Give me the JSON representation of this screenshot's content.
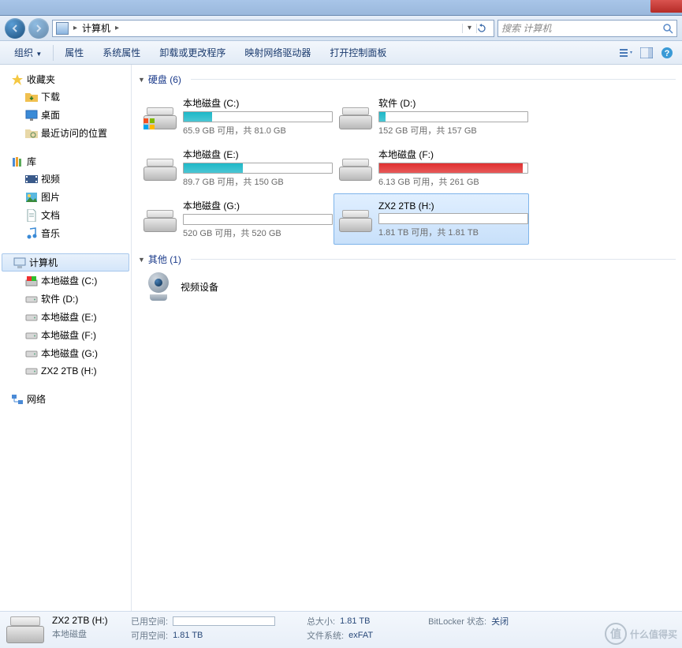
{
  "title_bar": {
    "location": "计算机"
  },
  "search": {
    "placeholder": "搜索 计算机"
  },
  "toolbar": {
    "organize": "组织",
    "dd": "▼",
    "properties": "属性",
    "sysprops": "系统属性",
    "uninstall": "卸载或更改程序",
    "mapnet": "映射网络驱动器",
    "controlpanel": "打开控制面板"
  },
  "sidebar": {
    "favorites": "收藏夹",
    "fav_items": [
      {
        "label": "下载"
      },
      {
        "label": "桌面"
      },
      {
        "label": "最近访问的位置"
      }
    ],
    "libraries": "库",
    "lib_items": [
      {
        "label": "视频"
      },
      {
        "label": "图片"
      },
      {
        "label": "文档"
      },
      {
        "label": "音乐"
      }
    ],
    "computer": "计算机",
    "comp_items": [
      {
        "label": "本地磁盘 (C:)"
      },
      {
        "label": "软件 (D:)"
      },
      {
        "label": "本地磁盘 (E:)"
      },
      {
        "label": "本地磁盘 (F:)"
      },
      {
        "label": "本地磁盘 (G:)"
      },
      {
        "label": "ZX2 2TB (H:)"
      }
    ],
    "network": "网络"
  },
  "content": {
    "hdd_header": "硬盘 (6)",
    "drives": [
      {
        "name": "本地磁盘 (C:)",
        "stat": "65.9 GB 可用，共 81.0 GB",
        "pct": 19,
        "color": "#1eb8c8",
        "win": true
      },
      {
        "name": "软件 (D:)",
        "stat": "152 GB 可用，共 157 GB",
        "pct": 4,
        "color": "#1eb8c8"
      },
      {
        "name": "本地磁盘 (E:)",
        "stat": "89.7 GB 可用，共 150 GB",
        "pct": 40,
        "color": "#1eb8c8"
      },
      {
        "name": "本地磁盘 (F:)",
        "stat": "6.13 GB 可用，共 261 GB",
        "pct": 97,
        "color": "#e03030"
      },
      {
        "name": "本地磁盘 (G:)",
        "stat": "520 GB 可用，共 520 GB",
        "pct": 0,
        "color": "#1eb8c8"
      },
      {
        "name": "ZX2 2TB (H:)",
        "stat": "1.81 TB 可用，共 1.81 TB",
        "pct": 0,
        "color": "#1eb8c8",
        "sel": true
      }
    ],
    "other_header": "其他 (1)",
    "device": "视频设备"
  },
  "details": {
    "name": "ZX2 2TB (H:)",
    "type": "本地磁盘",
    "used_label": "已用空间:",
    "avail_label": "可用空间:",
    "avail_val": "1.81 TB",
    "total_label": "总大小:",
    "total_val": "1.81 TB",
    "fs_label": "文件系统:",
    "fs_val": "exFAT",
    "bitlocker_label": "BitLocker 状态:",
    "bitlocker_val": "关闭"
  },
  "watermark": {
    "char": "值",
    "text": "什么值得买"
  }
}
